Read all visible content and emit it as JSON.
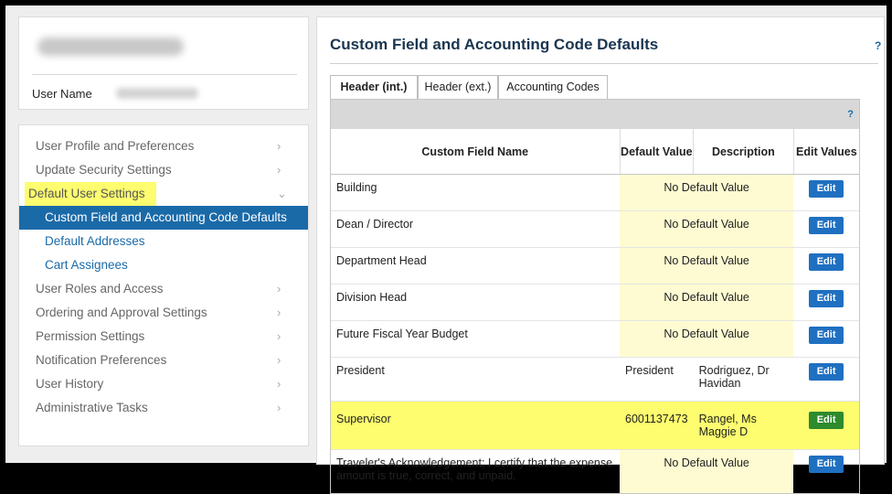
{
  "user": {
    "label": "User Name"
  },
  "menu": [
    {
      "label": "User Profile and Preferences",
      "chev": "›"
    },
    {
      "label": "Update Security Settings",
      "chev": "›"
    },
    {
      "label": "Default User Settings",
      "chev": "⌄"
    },
    {
      "label": "Custom Field and Accounting Code Defaults"
    },
    {
      "label": "Default Addresses"
    },
    {
      "label": "Cart Assignees"
    },
    {
      "label": "User Roles and Access",
      "chev": "›"
    },
    {
      "label": "Ordering and Approval Settings",
      "chev": "›"
    },
    {
      "label": "Permission Settings",
      "chev": "›"
    },
    {
      "label": "Notification Preferences",
      "chev": "›"
    },
    {
      "label": "User History",
      "chev": "›"
    },
    {
      "label": "Administrative Tasks",
      "chev": "›"
    }
  ],
  "panel": {
    "title": "Custom Field and Accounting Code Defaults",
    "help": "?",
    "tabs": [
      "Header (int.)",
      "Header (ext.)",
      "Accounting Codes"
    ],
    "table_help": "?"
  },
  "table": {
    "headers": [
      "Custom Field Name",
      "Default Value",
      "Description",
      "Edit Values"
    ],
    "rows": [
      {
        "name": "Building",
        "value": "No Default Value",
        "desc": "",
        "edit": "Edit"
      },
      {
        "name": "Dean / Director",
        "value": "No Default Value",
        "desc": "",
        "edit": "Edit"
      },
      {
        "name": "Department Head",
        "value": "No Default Value",
        "desc": "",
        "edit": "Edit"
      },
      {
        "name": "Division Head",
        "value": "No Default Value",
        "desc": "",
        "edit": "Edit"
      },
      {
        "name": "Future Fiscal Year Budget",
        "value": "No Default Value",
        "desc": "",
        "edit": "Edit"
      },
      {
        "name": "President",
        "value": "President",
        "desc": "Rodriguez, Dr Havidan",
        "edit": "Edit"
      },
      {
        "name": "Supervisor",
        "value": "6001137473",
        "desc": "Rangel, Ms Maggie D",
        "edit": "Edit"
      },
      {
        "name": "Traveler's Acknowledgement; I certify that the expense amount is true, correct, and unpaid.",
        "value": "No Default Value",
        "desc": "",
        "edit": "Edit"
      }
    ]
  },
  "colors": {
    "accent": "#1a6aa8",
    "highlight": "#fdfd6f",
    "edit_button": "#1f70c1",
    "edit_button_active": "#2d8a2d"
  }
}
